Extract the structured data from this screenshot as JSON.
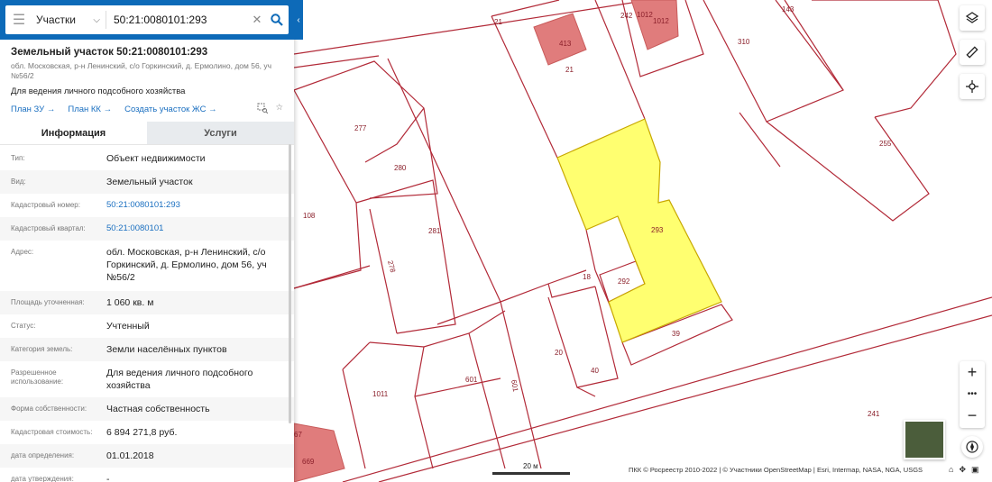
{
  "search": {
    "category": "Участки",
    "query": "50:21:0080101:293"
  },
  "object": {
    "title": "Земельный участок 50:21:0080101:293",
    "address": "обл. Московская, р-н Ленинский, с/о Горкинский, д. Ермолино, дом 56, уч №56/2",
    "use": "Для ведения личного подсобного хозяйства",
    "links": [
      "План ЗУ",
      "План КК",
      "Создать участок ЖС"
    ]
  },
  "tabs": [
    "Информация",
    "Услуги"
  ],
  "info_rows": [
    {
      "k": "Тип:",
      "v": "Объект недвижимости",
      "link": false
    },
    {
      "k": "Вид:",
      "v": "Земельный участок",
      "link": false
    },
    {
      "k": "Кадастровый номер:",
      "v": "50:21:0080101:293",
      "link": true
    },
    {
      "k": "Кадастровый квартал:",
      "v": "50:21:0080101",
      "link": true
    },
    {
      "k": "Адрес:",
      "v": "обл. Московская, р-н Ленинский, с/о Горкинский, д. Ермолино, дом 56, уч №56/2",
      "link": false
    },
    {
      "k": "Площадь уточненная:",
      "v": "1 060 кв. м",
      "link": false
    },
    {
      "k": "Статус:",
      "v": "Учтенный",
      "link": false
    },
    {
      "k": "Категория земель:",
      "v": "Земли населённых пунктов",
      "link": false
    },
    {
      "k": "Разрешенное использование:",
      "v": "Для ведения личного подсобного хозяйства",
      "link": false
    },
    {
      "k": "Форма собственности:",
      "v": "Частная собственность",
      "link": false
    },
    {
      "k": "Кадастровая стоимость:",
      "v": "6 894 271,8 руб.",
      "link": false
    },
    {
      "k": "дата определения:",
      "v": "01.01.2018",
      "link": false
    },
    {
      "k": "дата утверждения:",
      "v": "-",
      "link": false
    }
  ],
  "map": {
    "parcel_labels": [
      "21",
      "242",
      "1012",
      "1012",
      "143",
      "310",
      "413",
      "21",
      "277",
      "280",
      "255",
      "108",
      "281",
      "293",
      "278",
      "18",
      "292",
      "39",
      "20",
      "40",
      "601",
      "601",
      "1011",
      "241",
      "669",
      "67"
    ],
    "scale": "20 м",
    "attribution": "ПКК © Росреестр 2010-2022 | © Участники OpenStreetMap | Esri, Intermap, NASA, NGA, USGS"
  },
  "colors": {
    "header": "#0d6ab8",
    "selected_parcel": "#ffff70",
    "parcel_border": "#b22a38",
    "building": "#e07c7c",
    "link": "#1a6fc0"
  }
}
